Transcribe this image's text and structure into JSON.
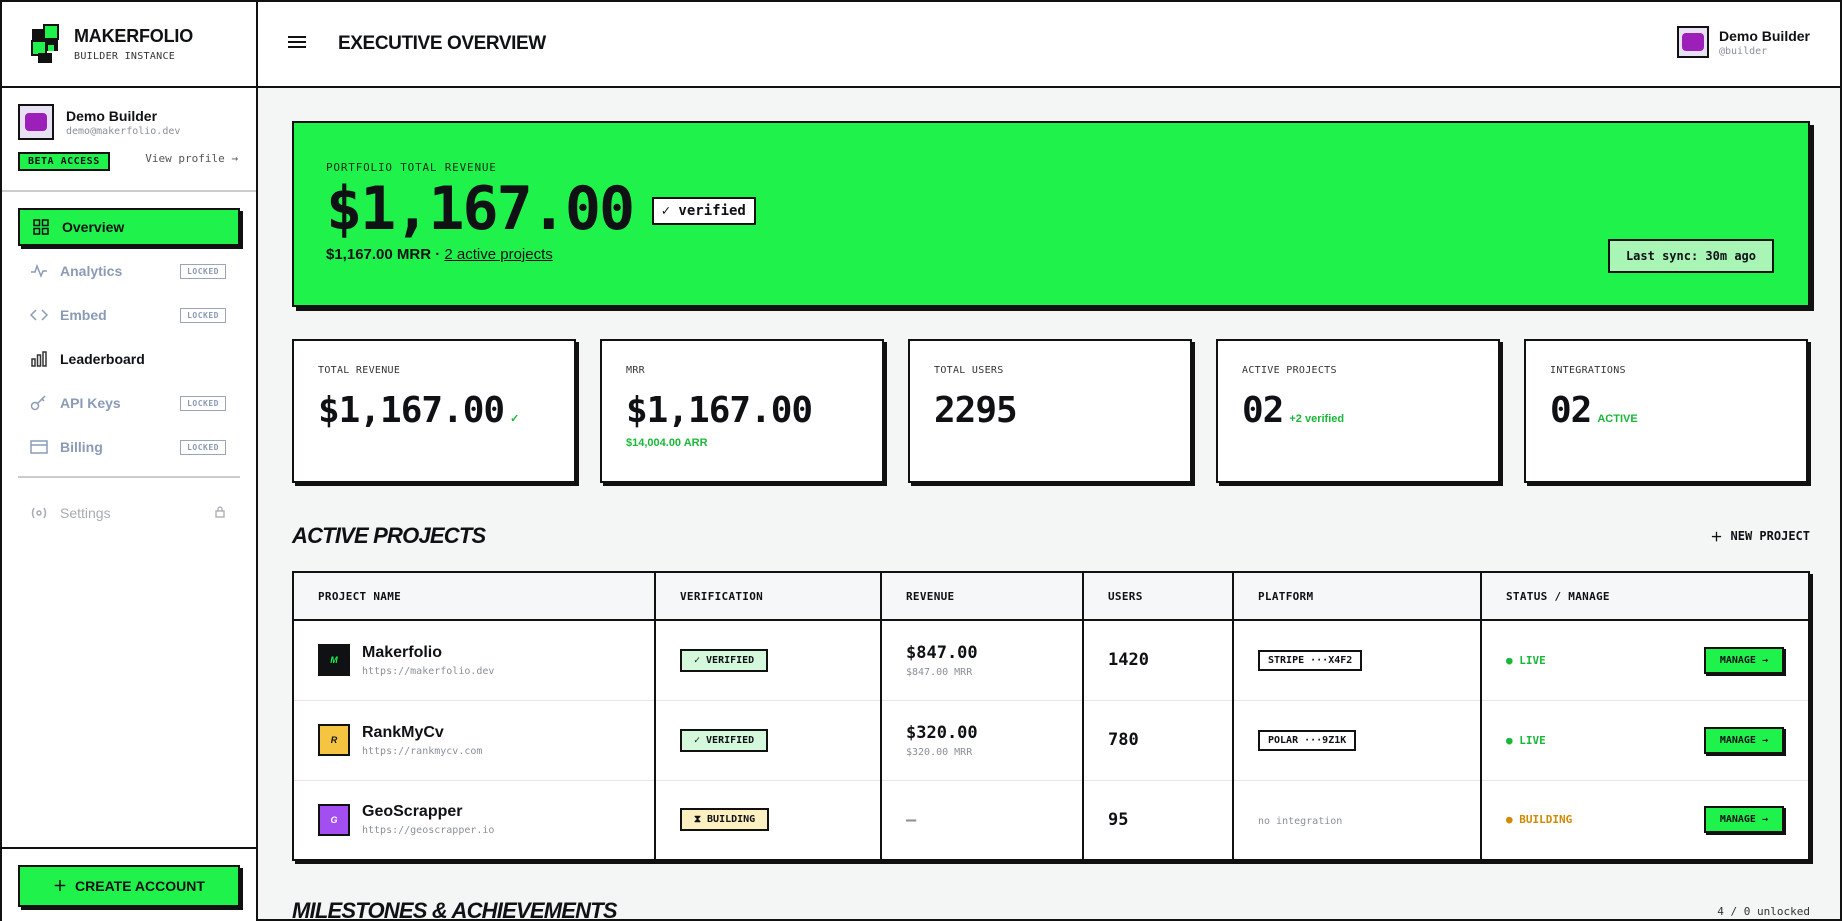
{
  "brand": {
    "title": "MAKERFOLIO",
    "subtitle": "BUILDER INSTANCE"
  },
  "sidebar_profile": {
    "name": "Demo Builder",
    "email": "demo@makerfolio.dev",
    "badge": "BETA ACCESS",
    "view_profile": "View profile →"
  },
  "nav": {
    "items": [
      {
        "label": "Overview",
        "icon": "grid-icon",
        "state": "active"
      },
      {
        "label": "Analytics",
        "icon": "activity-icon",
        "state": "locked",
        "badge": "LOCKED"
      },
      {
        "label": "Embed",
        "icon": "code-icon",
        "state": "locked",
        "badge": "LOCKED"
      },
      {
        "label": "Leaderboard",
        "icon": "bar-chart-icon",
        "state": "normal"
      },
      {
        "label": "API Keys",
        "icon": "key-icon",
        "state": "locked",
        "badge": "LOCKED"
      },
      {
        "label": "Billing",
        "icon": "card-icon",
        "state": "locked",
        "badge": "LOCKED"
      }
    ],
    "settings": "Settings"
  },
  "create_account": "CREATE ACCOUNT",
  "header": {
    "title": "EXECUTIVE OVERVIEW",
    "user_name": "Demo Builder",
    "user_handle": "@builder"
  },
  "hero": {
    "label": "PORTFOLIO TOTAL REVENUE",
    "amount": "$1,167.00",
    "verified": "✓ verified",
    "mrr_text": "$1,167.00 MRR · ",
    "projects_link": "2 active projects",
    "sync": "Last sync: 30m ago"
  },
  "stats": [
    {
      "label": "TOTAL REVENUE",
      "value": "$1,167.00",
      "extra": "✓",
      "below": ""
    },
    {
      "label": "MRR",
      "value": "$1,167.00",
      "extra": "",
      "below": "$14,004.00 ARR"
    },
    {
      "label": "TOTAL USERS",
      "value": "2295",
      "extra": "",
      "below": ""
    },
    {
      "label": "ACTIVE PROJECTS",
      "value": "02",
      "extra": "+2 verified",
      "below": ""
    },
    {
      "label": "INTEGRATIONS",
      "value": "02",
      "extra": "ACTIVE",
      "below": ""
    }
  ],
  "projects_section": {
    "title": "ACTIVE PROJECTS",
    "new_project": "NEW PROJECT"
  },
  "table": {
    "columns": [
      "PROJECT NAME",
      "VERIFICATION",
      "REVENUE",
      "USERS",
      "PLATFORM",
      "STATUS / MANAGE"
    ],
    "rows": [
      {
        "logo": "M",
        "logo_color": "#0f1115",
        "logo_text_color": "#1ff24a",
        "name": "Makerfolio",
        "url": "https://makerfolio.dev",
        "verification": "✓ VERIFIED",
        "vtype": "verified",
        "revenue": "$847.00",
        "revenue_sub": "$847.00 MRR",
        "users": "1420",
        "platform": "STRIPE ···X4F2",
        "status": "● LIVE",
        "stype": "live",
        "manage": "MANAGE →"
      },
      {
        "logo": "R",
        "logo_color": "#f5c542",
        "logo_text_color": "#0f1115",
        "name": "RankMyCv",
        "url": "https://rankmycv.com",
        "verification": "✓ VERIFIED",
        "vtype": "verified",
        "revenue": "$320.00",
        "revenue_sub": "$320.00 MRR",
        "users": "780",
        "platform": "POLAR ···9Z1K",
        "status": "● LIVE",
        "stype": "live",
        "manage": "MANAGE →"
      },
      {
        "logo": "G",
        "logo_color": "#a34ef0",
        "logo_text_color": "#ffffff",
        "name": "GeoScrapper",
        "url": "https://geoscrapper.io",
        "verification": "⧗ BUILDING",
        "vtype": "building",
        "revenue": "—",
        "revenue_sub": "",
        "users": "95",
        "platform": "no integration",
        "status": "● BUILDING",
        "stype": "building",
        "manage": "MANAGE →"
      }
    ]
  },
  "milestones": {
    "title": "MILESTONES & ACHIEVEMENTS",
    "unlocked": "4 / 0 unlocked"
  },
  "colors": {
    "accent": "#1ff24a",
    "ink": "#0f1115",
    "muted": "#8a8f98"
  }
}
